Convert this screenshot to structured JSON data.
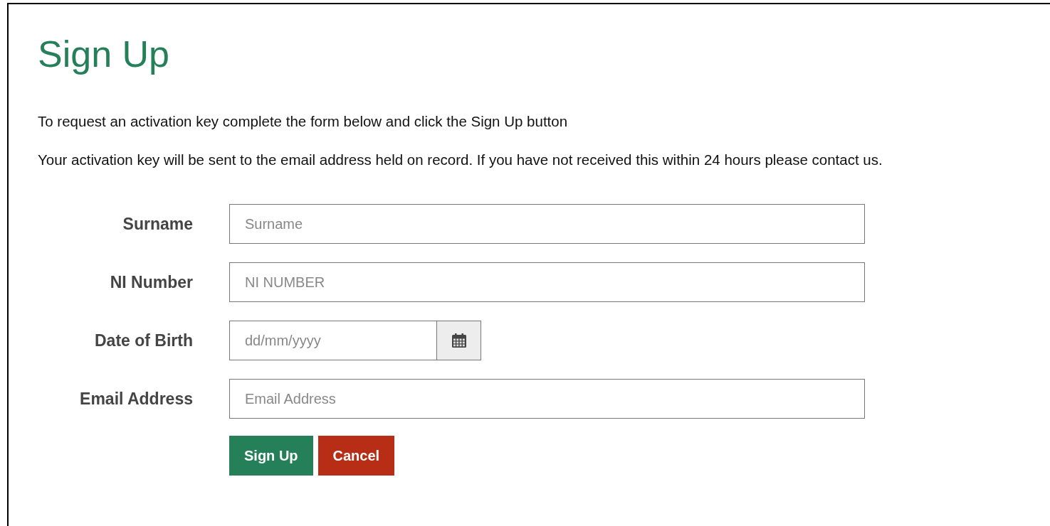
{
  "title": "Sign Up",
  "paragraphs": [
    "To request an activation key complete the form below and click the Sign Up button",
    "Your activation key will be sent to the email address held on record. If you have not received this within 24 hours please contact us."
  ],
  "fields": [
    {
      "kind": "text",
      "label": "Surname",
      "placeholder": "Surname"
    },
    {
      "kind": "text",
      "label": "NI Number",
      "placeholder": "NI NUMBER"
    },
    {
      "kind": "date",
      "label": "Date of Birth",
      "placeholder": "dd/mm/yyyy"
    },
    {
      "kind": "text",
      "label": "Email Address",
      "placeholder": "Email Address"
    }
  ],
  "buttons": [
    {
      "kind": "primary",
      "label": "Sign Up"
    },
    {
      "kind": "danger",
      "label": "Cancel"
    }
  ]
}
